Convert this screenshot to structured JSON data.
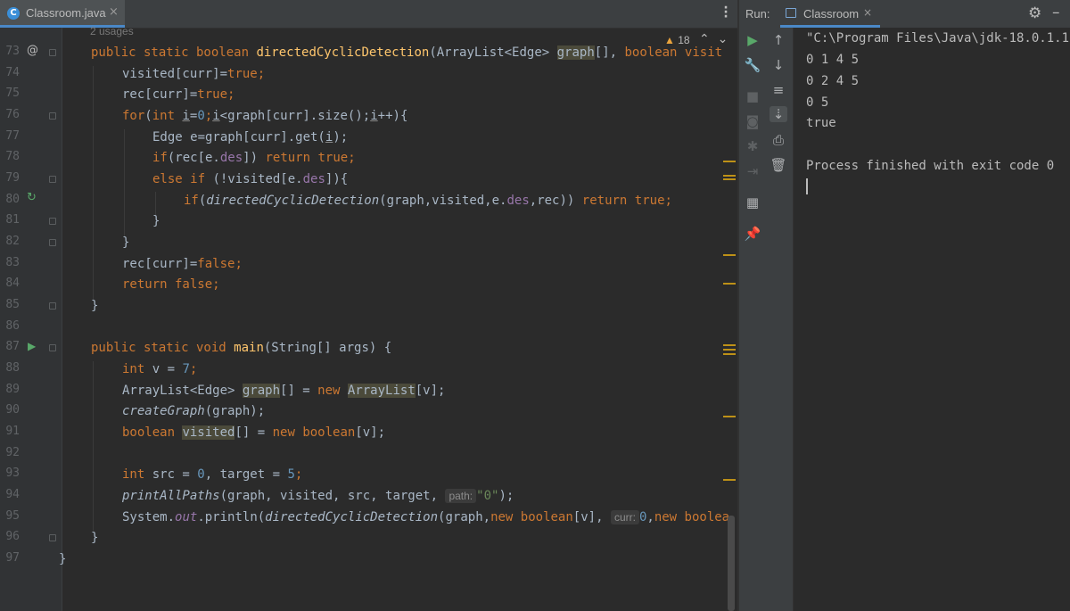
{
  "editor": {
    "tab": {
      "filename": "Classroom.java",
      "icon": "java-class-icon",
      "close": "×"
    },
    "usages_hint": "2 usages",
    "warnings": {
      "icon": "warning-triangle-icon",
      "count": "18"
    },
    "line_numbers": [
      "73",
      "74",
      "75",
      "76",
      "77",
      "78",
      "79",
      "80",
      "81",
      "82",
      "83",
      "84",
      "85",
      "86",
      "87",
      "88",
      "89",
      "90",
      "91",
      "92",
      "93",
      "94",
      "95",
      "96",
      "97"
    ],
    "gutter_marks": {
      "line73": "@",
      "line80_icon": "recursive-call-icon",
      "line87_icon": "run-gutter-icon"
    },
    "code": {
      "l73": {
        "pub": "public static boolean ",
        "name": "directedCyclicDetection",
        "p1": "(ArrayList<Edge> ",
        "graph": "graph",
        "p2": "[], ",
        "kw": "boolean visit"
      },
      "l74": {
        "a": "visited[curr]=",
        "b": "true",
        "c": ";"
      },
      "l75": {
        "a": "rec[curr]=",
        "b": "true",
        "c": ";"
      },
      "l76": {
        "a": "for",
        "b": "(",
        "c": "int ",
        "d": "i",
        "e": "=",
        "f": "0",
        "g": ";",
        "h": "i",
        "i": "<graph[curr].size();",
        "j": "i",
        "k": "++){"
      },
      "l77": {
        "a": "Edge e=graph[curr].get(",
        "b": "i",
        "c": ");"
      },
      "l78": {
        "a": "if",
        "b": "(rec[e.",
        "c": "des",
        "d": "]) ",
        "e": "return true",
        "f": ";"
      },
      "l79": {
        "a": "else if ",
        "b": "(!visited[e.",
        "c": "des",
        "d": "]){"
      },
      "l80": {
        "a": "if",
        "b": "(",
        "c": "directedCyclicDetection",
        "d": "(graph,visited,e.",
        "e": "des",
        "f": ",rec)) ",
        "g": "return true",
        "h": ";"
      },
      "l81": "}",
      "l82": "}",
      "l83": {
        "a": "rec[curr]=",
        "b": "false",
        "c": ";"
      },
      "l84": {
        "a": "return false",
        "b": ";"
      },
      "l85": "}",
      "l87": {
        "a": "public static void ",
        "b": "main",
        "c": "(String[] args) {"
      },
      "l88": {
        "a": "int ",
        "b": "v = ",
        "c": "7",
        "d": ";"
      },
      "l89": {
        "a": "ArrayList<Edge> ",
        "b": "graph",
        "c": "[] = ",
        "d": "new ",
        "e": "ArrayList",
        "f": "[v];"
      },
      "l90": {
        "a": "createGraph",
        "b": "(graph);"
      },
      "l91": {
        "a": "boolean ",
        "b": "visited",
        "c": "[] = ",
        "d": "new boolean",
        "e": "[v];"
      },
      "l93": {
        "a": "int ",
        "b": "src = ",
        "c": "0",
        "d": ", target = ",
        "e": "5",
        "f": ";"
      },
      "l94": {
        "a": "printAllPaths",
        "b": "(graph, visited, src, target, ",
        "hint": "path:",
        "c": "\"0\"",
        "d": ");"
      },
      "l95": {
        "a": "System.",
        "b": "out",
        "c": ".println(",
        "d": "directedCyclicDetection",
        "e": "(graph,",
        "f": "new boolean",
        "g": "[v], ",
        "hint": "curr:",
        "h": "0",
        "i": ",",
        "j": "new boolea"
      },
      "l96": "}",
      "l97": "}"
    }
  },
  "run": {
    "label": "Run:",
    "tab_name": "Classroom",
    "tab_close": "×",
    "console": [
      "\"C:\\Program Files\\Java\\jdk-18.0.1.1",
      "0 1 4 5",
      "0 2 4 5",
      "0 5",
      "true",
      "",
      "Process finished with exit code 0"
    ]
  },
  "colors": {
    "keyword": "#cc7832",
    "method": "#ffc66d",
    "number": "#6897bb",
    "string": "#6a8759",
    "field": "#9876aa",
    "text": "#a9b7c6",
    "background": "#2b2b2b"
  }
}
